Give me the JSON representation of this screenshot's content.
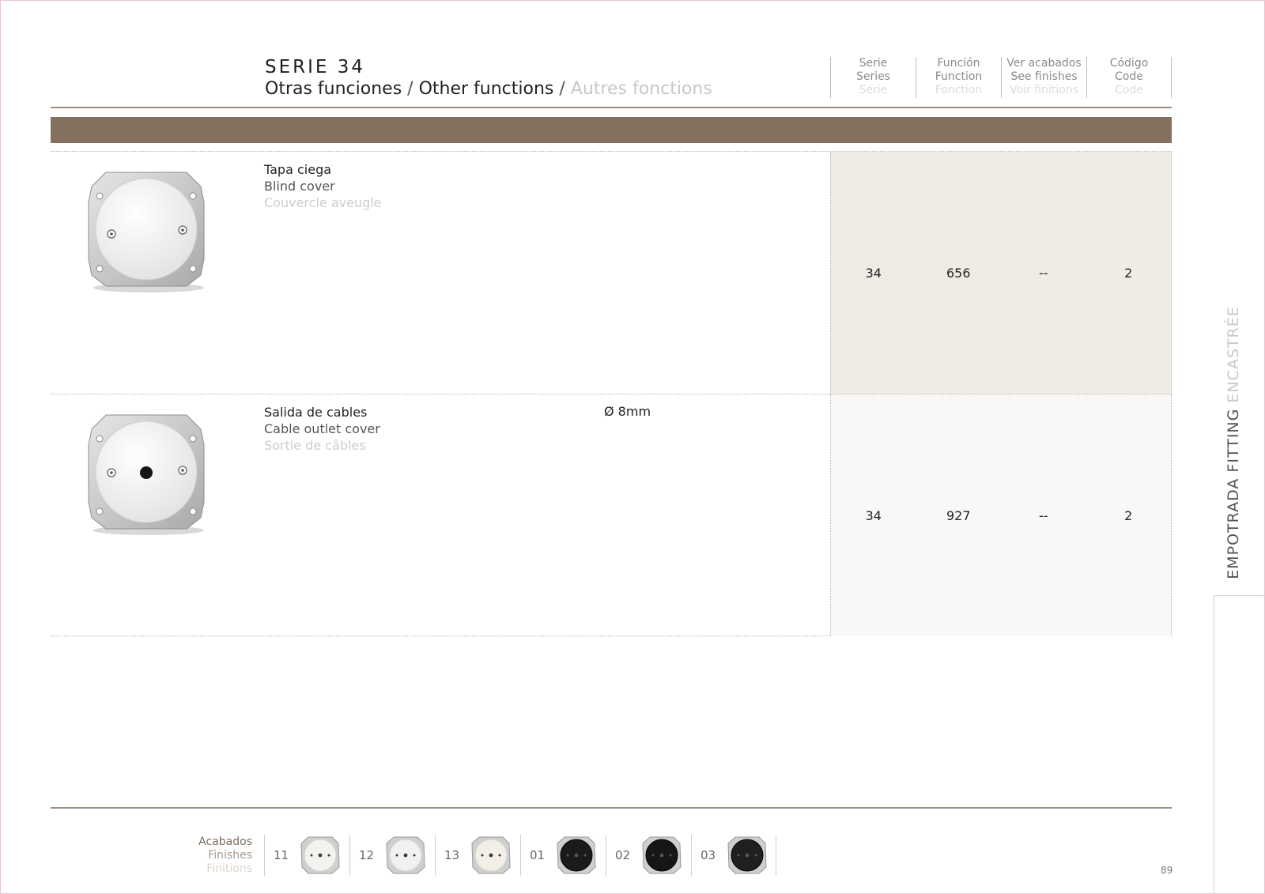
{
  "header": {
    "series_title": "SERIE 34",
    "subtitle_es": "Otras funciones",
    "subtitle_en": "Other functions",
    "subtitle_fr": "Autres fonctions",
    "separator": " / "
  },
  "columns": [
    {
      "es": "Serie",
      "en": "Series",
      "fr": "Série"
    },
    {
      "es": "Función",
      "en": "Function",
      "fr": "Fonction"
    },
    {
      "es": "Ver acabados",
      "en": "See finishes",
      "fr": "Voir finitions"
    },
    {
      "es": "Código",
      "en": "Code",
      "fr": "Code"
    }
  ],
  "products": [
    {
      "name_es": "Tapa ciega",
      "name_en": "Blind cover",
      "name_fr": "Couvercle aveugle",
      "spec": "",
      "icon": "blind-cover-icon",
      "serie": "34",
      "function": "656",
      "finishes": "--",
      "code": "2"
    },
    {
      "name_es": "Salida de cables",
      "name_en": "Cable outlet cover",
      "name_fr": "Sortie de câbles",
      "spec": "Ø 8mm",
      "icon": "cable-outlet-icon",
      "serie": "34",
      "function": "927",
      "finishes": "--",
      "code": "2"
    }
  ],
  "side_tab": {
    "label_a": "EMPOTRADA FITTING ",
    "label_b": "ENCASTRÉE"
  },
  "finishes": {
    "label_es": "Acabados",
    "label_en": "Finishes",
    "label_fr": "Finitions",
    "items": [
      {
        "code": "11",
        "icon": "white-finish-icon",
        "color": "#f4f2ee"
      },
      {
        "code": "12",
        "icon": "white-finish-icon",
        "color": "#f1f1f1"
      },
      {
        "code": "13",
        "icon": "ivory-finish-icon",
        "color": "#f3efe6"
      },
      {
        "code": "01",
        "icon": "black-finish-icon",
        "color": "#1b1b1b"
      },
      {
        "code": "02",
        "icon": "black-finish-icon",
        "color": "#161616"
      },
      {
        "code": "03",
        "icon": "black-finish-icon",
        "color": "#202020"
      }
    ]
  },
  "page_number": "89",
  "colors": {
    "band": "#84705f",
    "row1_bg": "#f0ebe5",
    "row2_bg": "#f9f8f6"
  }
}
